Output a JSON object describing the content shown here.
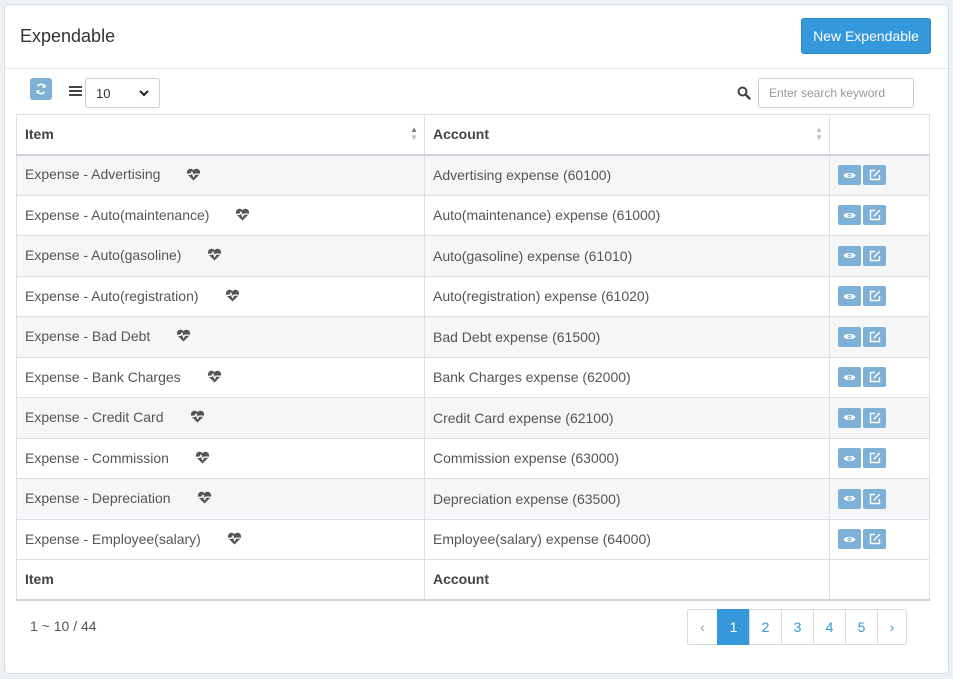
{
  "header": {
    "title": "Expendable",
    "new_button": "New Expendable"
  },
  "toolbar": {
    "page_size": "10",
    "search_placeholder": "Enter search keyword"
  },
  "table": {
    "columns": [
      "Item",
      "Account",
      ""
    ],
    "rows": [
      {
        "item": "Expense - Advertising",
        "account": "Advertising expense (60100)"
      },
      {
        "item": "Expense - Auto(maintenance)",
        "account": "Auto(maintenance) expense (61000)"
      },
      {
        "item": "Expense - Auto(gasoline)",
        "account": "Auto(gasoline) expense (61010)"
      },
      {
        "item": "Expense - Auto(registration)",
        "account": "Auto(registration) expense (61020)"
      },
      {
        "item": "Expense - Bad Debt",
        "account": "Bad Debt expense (61500)"
      },
      {
        "item": "Expense - Bank Charges",
        "account": "Bank Charges expense (62000)"
      },
      {
        "item": "Expense - Credit Card",
        "account": "Credit Card expense (62100)"
      },
      {
        "item": "Expense - Commission",
        "account": "Commission expense (63000)"
      },
      {
        "item": "Expense - Depreciation",
        "account": "Depreciation expense (63500)"
      },
      {
        "item": "Expense - Employee(salary)",
        "account": "Employee(salary) expense (64000)"
      }
    ],
    "footer": [
      "Item",
      "Account"
    ]
  },
  "pagination": {
    "summary": "1 ~ 10 / 44",
    "prev": "‹",
    "pages": [
      "1",
      "2",
      "3",
      "4",
      "5"
    ],
    "next": "›",
    "active_page": "1"
  },
  "colors": {
    "accent": "#3498db",
    "action_button": "#7fb0d6"
  },
  "icons": {
    "refresh": "refresh-icon",
    "menu": "list-icon",
    "search": "search-icon",
    "row_status": "heartbeat-icon",
    "view": "eye-icon",
    "edit": "edit-icon"
  }
}
